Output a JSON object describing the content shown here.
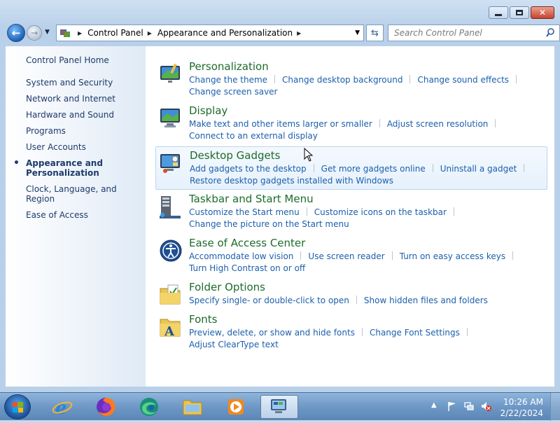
{
  "address": {
    "segments": [
      "Control Panel",
      "Appearance and Personalization"
    ]
  },
  "search": {
    "placeholder": "Search Control Panel"
  },
  "sidebar": {
    "home": "Control Panel Home",
    "items": [
      {
        "label": "System and Security"
      },
      {
        "label": "Network and Internet"
      },
      {
        "label": "Hardware and Sound"
      },
      {
        "label": "Programs"
      },
      {
        "label": "User Accounts"
      },
      {
        "label": "Appearance and Personalization"
      },
      {
        "label": "Clock, Language, and Region"
      },
      {
        "label": "Ease of Access"
      }
    ]
  },
  "categories": [
    {
      "title": "Personalization",
      "links": [
        "Change the theme",
        "Change desktop background",
        "Change sound effects",
        "Change screen saver"
      ]
    },
    {
      "title": "Display",
      "links": [
        "Make text and other items larger or smaller",
        "Adjust screen resolution",
        "Connect to an external display"
      ]
    },
    {
      "title": "Desktop Gadgets",
      "links": [
        "Add gadgets to the desktop",
        "Get more gadgets online",
        "Uninstall a gadget",
        "Restore desktop gadgets installed with Windows"
      ]
    },
    {
      "title": "Taskbar and Start Menu",
      "links": [
        "Customize the Start menu",
        "Customize icons on the taskbar",
        "Change the picture on the Start menu"
      ]
    },
    {
      "title": "Ease of Access Center",
      "links": [
        "Accommodate low vision",
        "Use screen reader",
        "Turn on easy access keys",
        "Turn High Contrast on or off"
      ]
    },
    {
      "title": "Folder Options",
      "links": [
        "Specify single- or double-click to open",
        "Show hidden files and folders"
      ]
    },
    {
      "title": "Fonts",
      "links": [
        "Preview, delete, or show and hide fonts",
        "Change Font Settings",
        "Adjust ClearType text"
      ]
    }
  ],
  "clock": {
    "time": "10:26 AM",
    "date": "2/22/2024"
  },
  "colors": {
    "category_title": "#1e6b2b",
    "link": "#1c5fac",
    "sidebar_text": "#1e3b6a"
  }
}
